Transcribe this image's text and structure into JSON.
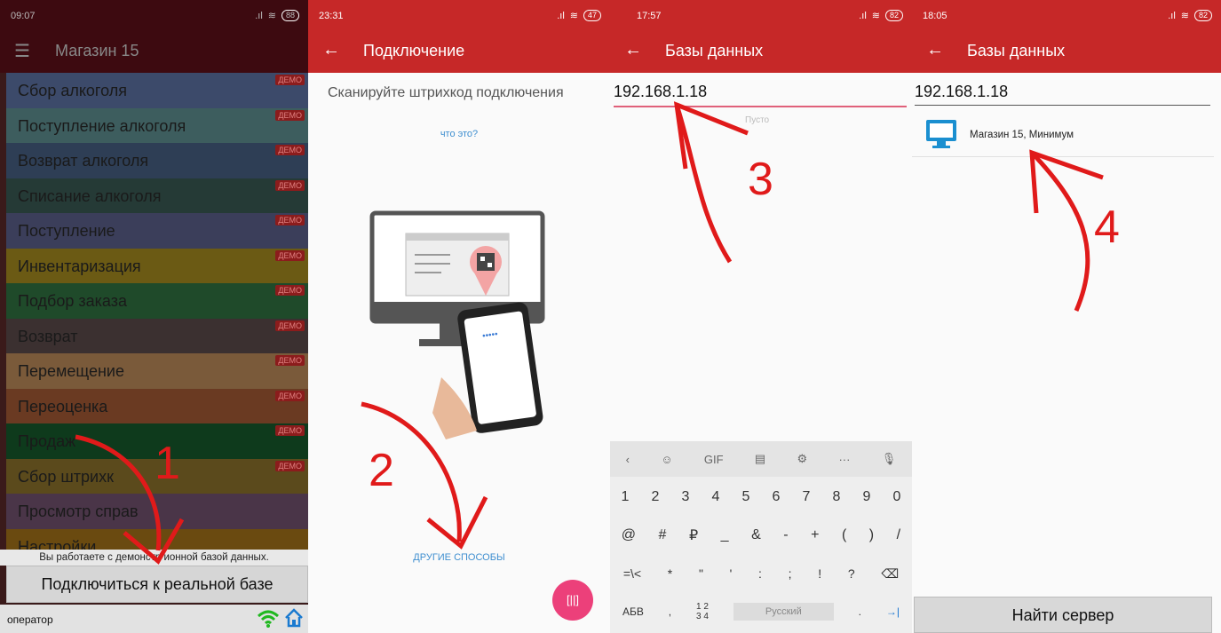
{
  "panel1": {
    "time": "09:07",
    "battery": "88",
    "title": "Магазин 15",
    "menu": [
      {
        "label": "Сбор алкоголя",
        "demo": "ДЕМО",
        "color": "#3c4a6a"
      },
      {
        "label": "Поступление алкоголя",
        "demo": "ДЕМО",
        "color": "#3d5d5e"
      },
      {
        "label": "Возврат алкоголя",
        "demo": "ДЕМО",
        "color": "#2e3e55"
      },
      {
        "label": "Списание алкоголя",
        "demo": "ДЕМО",
        "color": "#253a36"
      },
      {
        "label": "Поступление",
        "demo": "ДЕМО",
        "color": "#3b3e5a"
      },
      {
        "label": "Инвентаризация",
        "demo": "ДЕМО",
        "color": "#6b5a14"
      },
      {
        "label": "Подбор заказа",
        "demo": "ДЕМО",
        "color": "#1f4a2a"
      },
      {
        "label": "Возврат",
        "demo": "ДЕМО",
        "color": "#3b3030"
      },
      {
        "label": "Перемещение",
        "demo": "ДЕМО",
        "color": "#7a5a3a"
      },
      {
        "label": "Переоценка",
        "demo": "ДЕМО",
        "color": "#6a3a22"
      },
      {
        "label": "Продаж",
        "demo": "ДЕМО",
        "color": "#0e3a1c"
      },
      {
        "label": "Сбор штрихк",
        "demo": "ДЕМО",
        "color": "#5b4a1c"
      },
      {
        "label": "Просмотр справ",
        "demo": "",
        "color": "#4a3548"
      },
      {
        "label": "Настройки",
        "demo": "",
        "color": "#6a4a10"
      }
    ],
    "notice": "Вы работаете с демонстр ионной базой данных.",
    "connect_label": "Подключиться к реальной базе",
    "operator": "оператор",
    "step": "1"
  },
  "panel2": {
    "time": "23:31",
    "battery": "47",
    "title": "Подключение",
    "scan_title": "Сканируйте штрихкод подключения",
    "what_link": "что это?",
    "other_link": "ДРУГИЕ СПОСОБЫ",
    "step": "2"
  },
  "panel3": {
    "time": "17:57",
    "battery": "82",
    "title": "Базы данных",
    "ip_value": "192.168.1.18",
    "empty": "Пусто",
    "kbd_top": [
      "‹",
      "☺",
      "GIF",
      "▤",
      "⚙",
      "···",
      "🎙"
    ],
    "kbd_row1": [
      "1",
      "2",
      "3",
      "4",
      "5",
      "6",
      "7",
      "8",
      "9",
      "0"
    ],
    "kbd_row2": [
      "@",
      "#",
      "₽",
      "_",
      "&",
      "-",
      "+",
      "(",
      ")",
      "/"
    ],
    "kbd_row3": [
      "=\\<",
      "*",
      "\"",
      "'",
      ":",
      ";",
      "!",
      "?",
      "⌫"
    ],
    "kbd_abc": "АБВ",
    "kbd_comma": ",",
    "kbd_num": "1 2 3 4",
    "kbd_space": "Русский",
    "kbd_dot": ".",
    "kbd_enter": "→|",
    "step": "3"
  },
  "panel4": {
    "time": "18:05",
    "battery": "82",
    "title": "Базы данных",
    "ip_value": "192.168.1.18",
    "db_name": "Магазин 15, Минимум",
    "find_label": "Найти сервер",
    "step": "4"
  }
}
